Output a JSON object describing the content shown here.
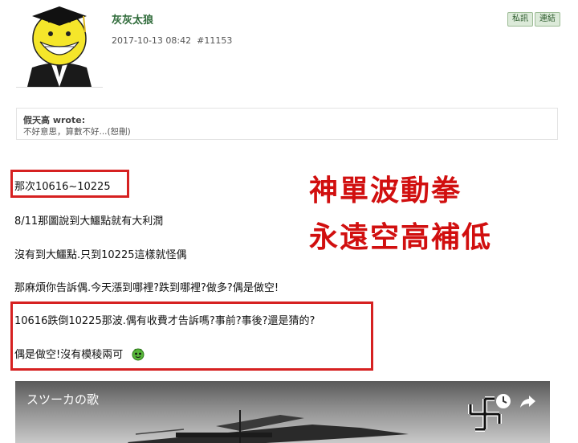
{
  "header": {
    "username": "灰灰太狼",
    "timestamp": "2017-10-13 08:42",
    "post_id": "#11153",
    "buttons": [
      "私訊",
      "連結"
    ]
  },
  "quote": {
    "author": "假天高 wrote:",
    "text": "不好意思，算數不好...(恕刪)"
  },
  "body": {
    "line1": "那次10616~10225",
    "line2": "8/11那圖說到大鱷點就有大利潤",
    "line3": "沒有到大鱷點.只到10225這樣就怪偶",
    "line4": "那麻煩你告訴偶.今天漲到哪裡?跌到哪裡?做多?偶是做空!",
    "line5": "10616跌倒10225那波.偶有收費才告訴嗎?事前?事後?還是猜的?",
    "line6": "偶是做空!沒有模稜兩可"
  },
  "overlay": {
    "text1": "神單波動拳",
    "text2": "永遠空高補低"
  },
  "video": {
    "title": "スツーカの歌"
  },
  "icons": {
    "avatar": "koro-sensei-avatar",
    "emoji": "green-alien-smiley-icon",
    "clock": "clock-icon",
    "share": "share-arrow-icon"
  },
  "colors": {
    "highlight_red": "#d62121",
    "username_green": "#2f6b3a"
  }
}
